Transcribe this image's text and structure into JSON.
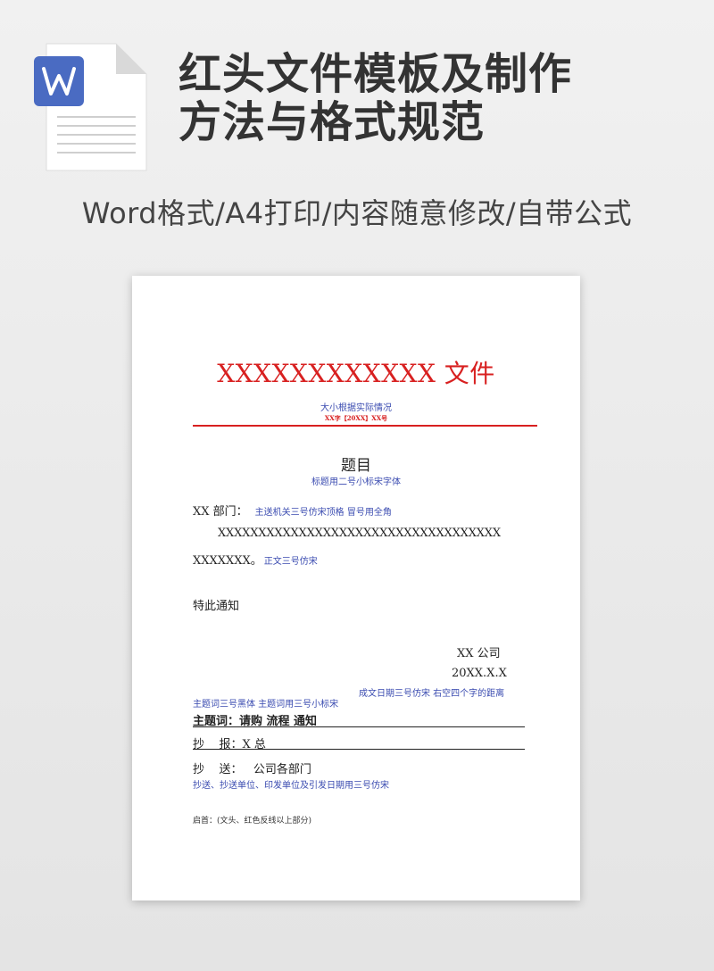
{
  "header": {
    "title_line1": "红头文件模板及制作",
    "title_line2": "方法与格式规范",
    "subtitle": "Word格式/A4打印/内容随意修改/自带公式",
    "icon": "word-document-icon",
    "icon_letter": "W",
    "icon_color": "#4a6bc2"
  },
  "document": {
    "red_title": "XXXXXXXXXXXX 文件",
    "note_size": "大小根据实际情况",
    "doc_number": "XX字【20XX】XX号",
    "heading": "题目",
    "note_heading": "标题用二号小标宋字体",
    "dept_label": "XX 部门：",
    "note_dept": "主送机关三号仿宋顶格  冒号用全角",
    "body_line1": "XXXXXXXXXXXXXXXXXXXXXXXXXXXXXXXXXXX",
    "body_line2": "XXXXXXX。",
    "note_body": "正文三号仿宋",
    "notice": "特此通知",
    "company": "XX 公司",
    "date": "20XX.X.X",
    "note_date": "成文日期三号仿宋  右空四个字的距离",
    "note_keywords": "主题词三号黑体  主题词用三号小标宋",
    "keywords_row": "主题词：请购  流程  通知",
    "report_row": "抄    报：X 总",
    "copy_row": "抄    送：   公司各部门",
    "note_copy": "抄送、抄送单位、印发单位及引发日期用三号仿宋",
    "footnote": "启首：(文头、红色反线以上部分)"
  },
  "colors": {
    "red": "#d82020",
    "note_blue": "#3a4bb0",
    "text": "#222222"
  }
}
